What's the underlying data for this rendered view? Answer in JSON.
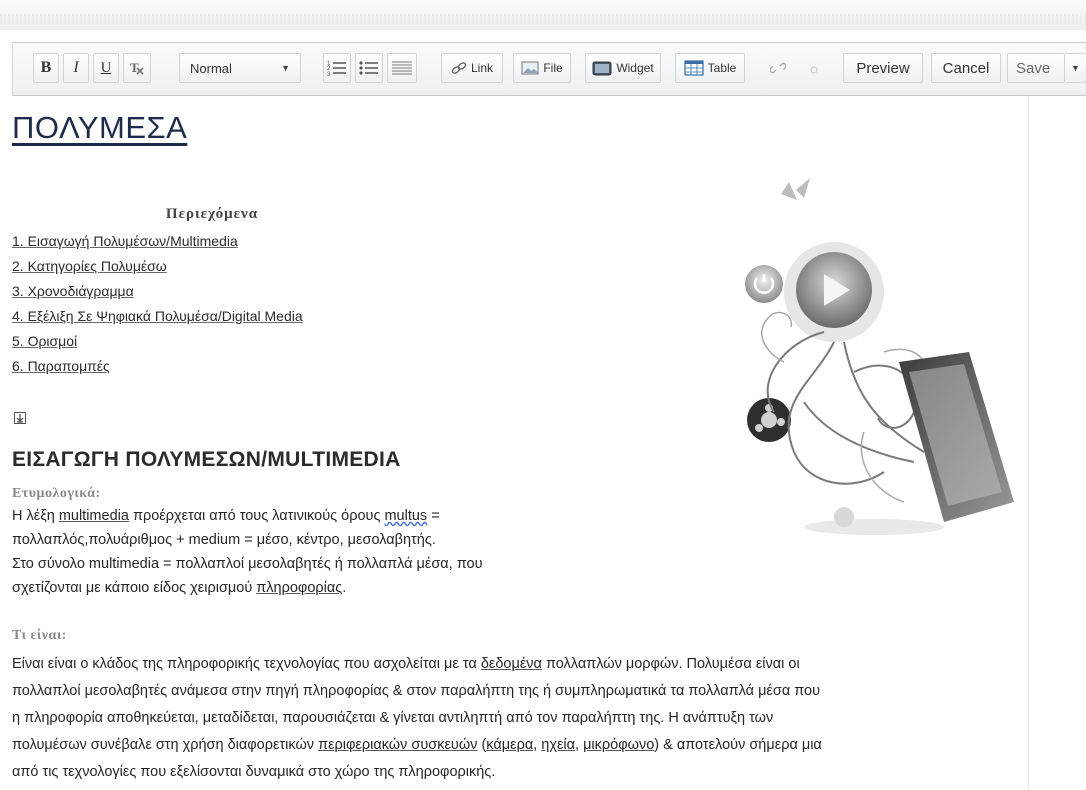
{
  "toolbar": {
    "bold": "B",
    "italic": "I",
    "underline": "U",
    "format_select": "Normal",
    "link_label": "Link",
    "file_label": "File",
    "widget_label": "Widget",
    "table_label": "Table",
    "preview_label": "Preview",
    "cancel_label": "Cancel",
    "save_label": "Save"
  },
  "page": {
    "title": "ΠΟΛΥΜΕΣΑ",
    "toc_title": "Περιεχόμενα",
    "toc_items": [
      "1. Εισαγωγή Πολυμέσων/Multimedia",
      "2. Κατηγορίες Πολυμέσω",
      "3. Χρονοδιάγραμμα",
      "4. Εξέλιξη Σε Ψηφιακά Πολυμέσα/Digital Media",
      "5. Ορισμοί",
      "6. Παραπομπές"
    ],
    "section_heading": "ΕΙΣΑΓΩΓΗ ΠΟΛΥΜΕΣΩΝ/MULTIMEDIA",
    "etym_label": "Ετυμολογικά:",
    "etym": {
      "l1_a": "Η λέξη ",
      "l1_link": "multimedia",
      "l1_b": " προέρχεται από τους λατινικούς όρους ",
      "l1_sq": "multus",
      "l1_c": " =",
      "l2": "πολλαπλός,πολυάριθμος + medium = μέσο, κέντρο, μεσολαβητής.",
      "l3": "Στο σύνολο multimedia = πολλαπλοί μεσολαβητές ή πολλαπλά μέσα, που",
      "l4_a": "σχετίζονται με κάποιο είδος χειρισμού ",
      "l4_link": "πληροφορίας",
      "l4_b": "."
    },
    "what_label": "Τι είναι:",
    "what": {
      "l1_a": "Είναι είναι ο κλάδος της πληροφορικής τεχνολογίας που ασχολείται με τα ",
      "l1_link": "δεδομένα",
      "l1_b": " πολλαπλών μορφών. Πολυμέσα είναι οι",
      "l2": "πολλαπλοί μεσολαβητές ανάμεσα στην πηγή πληροφορίας & στον παραλήπτη της ή συμπληρωματικά τα πολλαπλά μέσα που",
      "l3": "η πληροφορία αποθηκεύεται, μεταδίδεται, παρουσιάζεται & γίνεται αντιληπτή από τον παραλήπτη της. Η ανάπτυξη των",
      "l4_a": "πολυμέσων συνέβαλε στη χρήση διαφορετικών ",
      "l4_link1": "περιφεριακών συσκευών",
      "l4_b": " (",
      "l4_link2": "κάμερα",
      "l4_c": ", ",
      "l4_link3": "ηχεία",
      "l4_d": ", ",
      "l4_link4": "μικρόφωνο",
      "l4_e": ") & αποτελούν σήμερα μια",
      "l5": "από τις τεχνολογίες που εξελίσονται δυναμικά στο χώρο της πληροφορικής."
    }
  }
}
